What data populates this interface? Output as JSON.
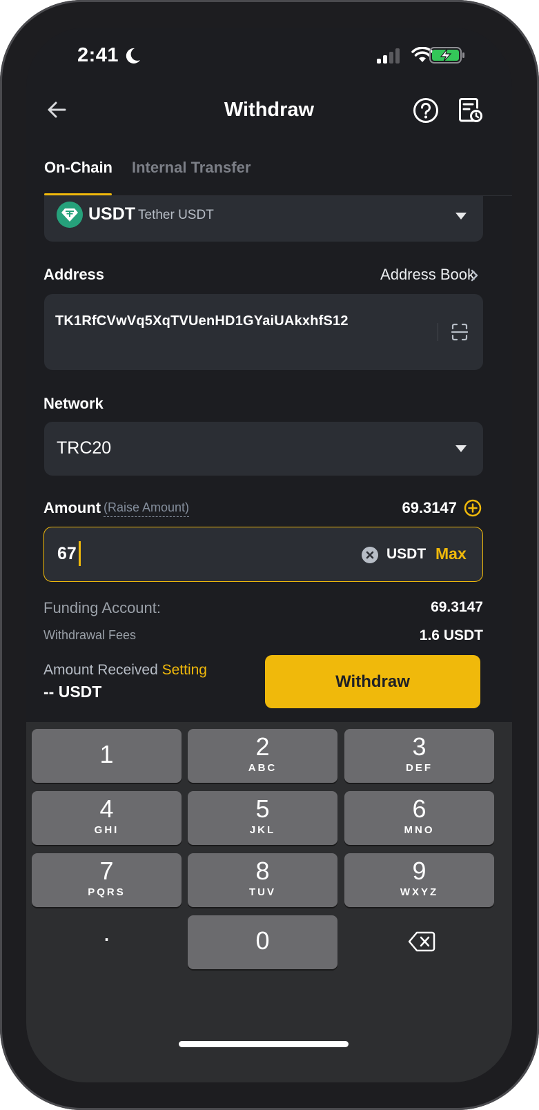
{
  "status_bar": {
    "time": "2:41",
    "moon_icon": "moon-icon",
    "signal_icon": "cellular-signal-icon",
    "wifi_icon": "wifi-icon",
    "battery_icon": "battery-charging-icon"
  },
  "header": {
    "title": "Withdraw",
    "back_icon": "arrow-left-icon",
    "help_icon": "question-circle-icon",
    "history_icon": "order-history-icon"
  },
  "tabs": [
    {
      "label": "On-Chain",
      "active": true
    },
    {
      "label": "Internal Transfer",
      "active": false
    }
  ],
  "coin": {
    "symbol": "USDT",
    "name": "Tether USDT",
    "logo_color": "#26A17B"
  },
  "address": {
    "label": "Address",
    "book_label": "Address Book",
    "value": "TK1RfCVwVq5XqTVUenHD1GYaiUAkxhfS12"
  },
  "network": {
    "label": "Network",
    "value": "TRC20"
  },
  "amount": {
    "label": "Amount",
    "raise_label": "(Raise Amount)",
    "balance": "69.3147",
    "value": "67",
    "unit": "USDT",
    "max_label": "Max"
  },
  "summary": {
    "funding_label": "Funding Account:",
    "funding_value": "69.3147",
    "fees_label": "Withdrawal Fees",
    "fees_value": "1.6 USDT",
    "received_label": "Amount Received",
    "setting_label": "Setting",
    "received_value": "-- USDT"
  },
  "withdraw_button": {
    "label": "Withdraw"
  },
  "colors": {
    "accent": "#F0B90B",
    "background": "#1C1D21",
    "surface": "#2B2E34",
    "keypad": "#2D2E30",
    "key": "#6B6B6E"
  },
  "keypad": {
    "keys": [
      {
        "num": "1",
        "letters": ""
      },
      {
        "num": "2",
        "letters": "ABC"
      },
      {
        "num": "3",
        "letters": "DEF"
      },
      {
        "num": "4",
        "letters": "GHI"
      },
      {
        "num": "5",
        "letters": "JKL"
      },
      {
        "num": "6",
        "letters": "MNO"
      },
      {
        "num": "7",
        "letters": "PQRS"
      },
      {
        "num": "8",
        "letters": "TUV"
      },
      {
        "num": "9",
        "letters": "WXYZ"
      },
      {
        "num": "0",
        "letters": ""
      }
    ],
    "decimal": ".",
    "backspace_icon": "backspace-icon"
  }
}
